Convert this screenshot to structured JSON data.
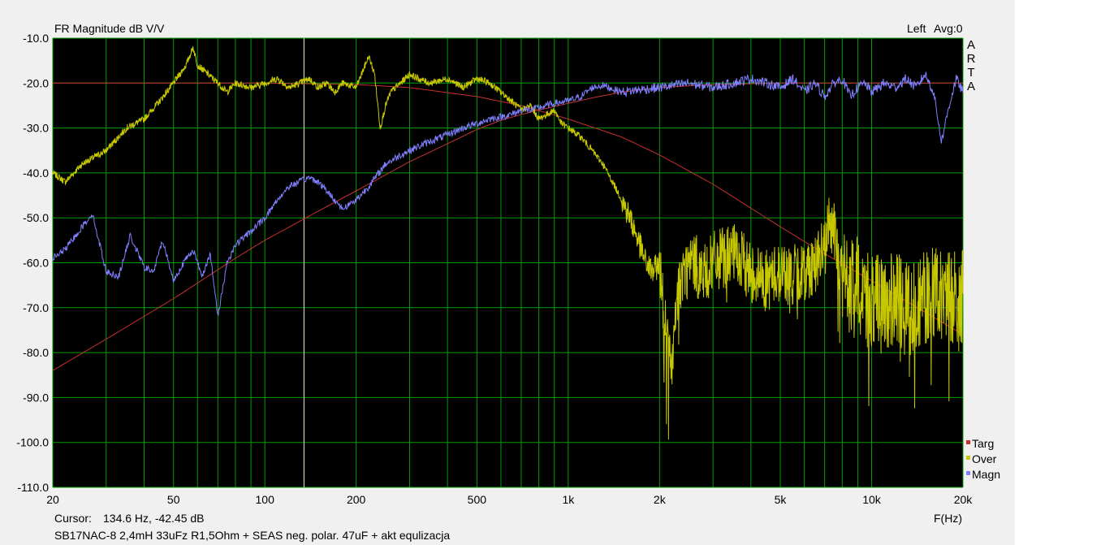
{
  "header": {
    "title": "FR Magnitude dB V/V",
    "channel": "Left",
    "avg": "Avg:0",
    "brand_letters": [
      "A",
      "R",
      "T",
      "A"
    ]
  },
  "footer": {
    "cursor_label": "Cursor:",
    "cursor_value": "134.6 Hz, -42.45 dB",
    "freq_label": "F(Hz)",
    "description": "SB17NAC-8 2,4mH 33uFz R1,5Ohm + SEAS neg. polar. 47uF + akt equlizacja"
  },
  "colors": {
    "plot_bg": "#000000",
    "grid": "#00a000",
    "cursor_line": "#f0f0c0",
    "targ": "#c83030",
    "over": "#c8c800",
    "magn": "#8080ff"
  },
  "chart_data": {
    "type": "line",
    "x_scale": "log",
    "xlim": [
      20,
      20000
    ],
    "ylim": [
      -110,
      -10
    ],
    "grid": true,
    "legend": "bottom-right",
    "x_ticks": [
      {
        "v": 20,
        "label": "20"
      },
      {
        "v": 50,
        "label": "50"
      },
      {
        "v": 100,
        "label": "100"
      },
      {
        "v": 200,
        "label": "200"
      },
      {
        "v": 500,
        "label": "500"
      },
      {
        "v": 1000,
        "label": "1k"
      },
      {
        "v": 2000,
        "label": "2k"
      },
      {
        "v": 5000,
        "label": "5k"
      },
      {
        "v": 10000,
        "label": "10k"
      },
      {
        "v": 20000,
        "label": "20k"
      }
    ],
    "y_ticks": [
      {
        "v": -10,
        "label": "-10.0"
      },
      {
        "v": -20,
        "label": "-20.0"
      },
      {
        "v": -30,
        "label": "-30.0"
      },
      {
        "v": -40,
        "label": "-40.0"
      },
      {
        "v": -50,
        "label": "-50.0"
      },
      {
        "v": -60,
        "label": "-60.0"
      },
      {
        "v": -70,
        "label": "-70.0"
      },
      {
        "v": -80,
        "label": "-80.0"
      },
      {
        "v": -90,
        "label": "-90.0"
      },
      {
        "v": -100,
        "label": "-100.0"
      },
      {
        "v": -110,
        "label": "-110.0"
      }
    ],
    "cursor": {
      "x": 134.6,
      "y": -42.45
    },
    "series": [
      {
        "name": "Targ",
        "color": "#c83030",
        "x": [
          20,
          30,
          50,
          80,
          100,
          150,
          200,
          300,
          400,
          500,
          600,
          700,
          800,
          1000,
          1200,
          1500,
          2000,
          3000,
          5000,
          7000,
          10000,
          15000,
          20000
        ],
        "y": [
          -84,
          -77,
          -68,
          -59,
          -55,
          -48.5,
          -44,
          -37.5,
          -33.5,
          -30.3,
          -28.3,
          -27,
          -26,
          -24.5,
          -23.3,
          -22,
          -21,
          -20.3,
          -20,
          -20,
          -20,
          -20,
          -20
        ],
        "x2": [
          20,
          50,
          100,
          200,
          300,
          500,
          700,
          1000,
          1500,
          2000,
          3000,
          5000,
          7000,
          10000,
          15000,
          20000
        ],
        "y2": [
          -20,
          -20,
          -20,
          -20.3,
          -21,
          -23,
          -25,
          -28,
          -32,
          -36,
          -42.5,
          -52,
          -58,
          -64,
          -71,
          -76
        ]
      },
      {
        "name": "Over",
        "color": "#c8c800",
        "x": [
          20,
          22,
          25,
          30,
          35,
          40,
          45,
          50,
          55,
          58,
          60,
          65,
          70,
          75,
          80,
          90,
          100,
          110,
          120,
          130,
          140,
          150,
          160,
          170,
          180,
          200,
          220,
          230,
          240,
          250,
          260,
          280,
          300,
          320,
          350,
          400,
          450,
          500,
          550,
          600,
          650,
          700,
          750,
          800,
          850,
          900,
          950,
          1000,
          1100,
          1200,
          1300,
          1400,
          1500,
          1600,
          1700,
          1800,
          1900,
          2000,
          2100,
          2200,
          2300,
          2400,
          2600,
          2800,
          3000,
          3500,
          4000,
          4500,
          5000,
          5500,
          6000,
          6500,
          7000,
          7300,
          7600,
          8000,
          8500,
          9000,
          10000,
          11000,
          12000,
          13000,
          15000,
          17000,
          20000
        ],
        "y": [
          -40,
          -42,
          -38,
          -35,
          -30,
          -28,
          -24,
          -20,
          -16,
          -12,
          -16,
          -18,
          -20,
          -22,
          -20,
          -21,
          -20,
          -19,
          -21,
          -20,
          -19,
          -21,
          -20,
          -22,
          -20,
          -21,
          -14,
          -18,
          -30,
          -25,
          -22,
          -20,
          -18,
          -19,
          -20,
          -19,
          -21,
          -19,
          -20,
          -22,
          -24,
          -26,
          -25,
          -28,
          -27,
          -26,
          -29,
          -30,
          -32,
          -35,
          -38,
          -42,
          -46,
          -50,
          -55,
          -60,
          -62,
          -60,
          -75,
          -85,
          -66,
          -62,
          -60,
          -63,
          -60,
          -58,
          -62,
          -64,
          -62,
          -63,
          -62,
          -60,
          -57,
          -50,
          -55,
          -63,
          -66,
          -65,
          -68,
          -70,
          -68,
          -70,
          -68,
          -67,
          -68
        ]
      },
      {
        "name": "Magn",
        "color": "#8080ff",
        "x": [
          20,
          22,
          25,
          27,
          30,
          33,
          36,
          40,
          43,
          46,
          50,
          54,
          58,
          62,
          66,
          70,
          75,
          80,
          90,
          100,
          110,
          120,
          130,
          140,
          150,
          160,
          170,
          180,
          200,
          220,
          250,
          280,
          300,
          350,
          400,
          450,
          500,
          550,
          600,
          650,
          700,
          750,
          800,
          900,
          1000,
          1100,
          1200,
          1300,
          1500,
          1700,
          2000,
          2500,
          3000,
          3500,
          4000,
          4500,
          5000,
          5500,
          6000,
          6500,
          7000,
          7500,
          8000,
          8500,
          9000,
          9500,
          10000,
          11000,
          12000,
          13000,
          14000,
          15000,
          16000,
          17000,
          18000,
          19000,
          20000
        ],
        "y": [
          -59,
          -57,
          -52,
          -49,
          -62,
          -63,
          -54,
          -61,
          -62,
          -55,
          -64,
          -60,
          -57,
          -63,
          -58,
          -72,
          -60,
          -56,
          -53,
          -50,
          -46,
          -43,
          -42,
          -41,
          -42,
          -44,
          -46,
          -48,
          -46,
          -43,
          -38,
          -36,
          -35,
          -33,
          -31.5,
          -30,
          -29,
          -28,
          -27.5,
          -27,
          -26,
          -26,
          -25.5,
          -24.5,
          -24,
          -23,
          -21,
          -20.5,
          -22,
          -21.5,
          -21,
          -20,
          -21,
          -20,
          -19,
          -20,
          -21,
          -19,
          -22,
          -20,
          -23,
          -20,
          -19,
          -23,
          -21,
          -20,
          -22,
          -20,
          -21,
          -19,
          -21,
          -18,
          -22,
          -33,
          -25,
          -19,
          -22
        ]
      }
    ]
  }
}
